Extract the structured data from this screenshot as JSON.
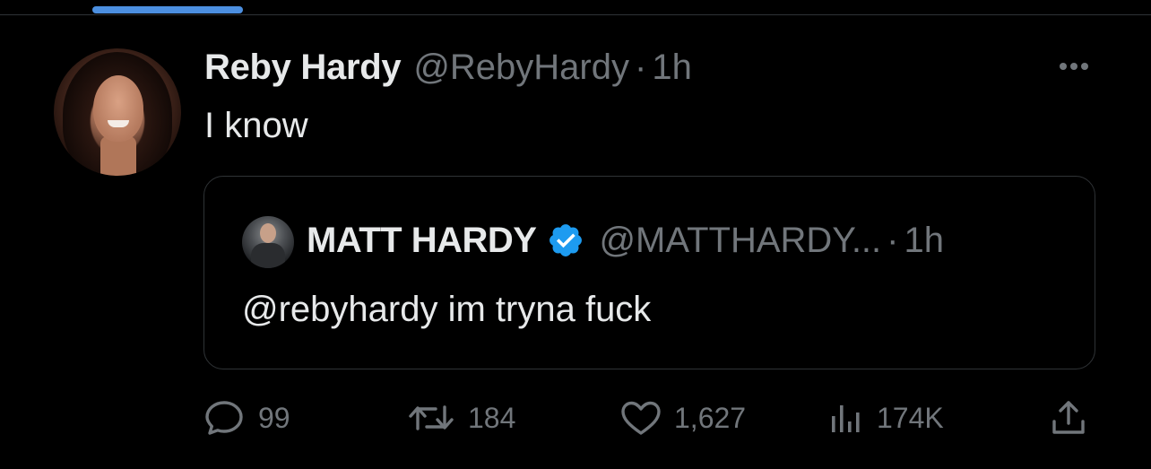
{
  "tweet": {
    "author": {
      "display_name": "Reby Hardy",
      "handle": "@RebyHardy",
      "separator": "·",
      "time": "1h"
    },
    "text": "I know",
    "quoted": {
      "display_name": "MATT HARDY",
      "handle": "@MATTHARDY...",
      "separator": "·",
      "time": "1h",
      "text": "@rebyhardy im tryna fuck"
    },
    "actions": {
      "replies": "99",
      "retweets": "184",
      "likes": "1,627",
      "views": "174K"
    }
  },
  "colors": {
    "background": "#000000",
    "primary_text": "#e7e9ea",
    "secondary_text": "#71767b",
    "border": "#2f3336",
    "verified_blue": "#1d9bf0",
    "tab_indicator": "#4c8fe0"
  },
  "icons": {
    "more": "more-horizontal-icon",
    "verified": "verified-badge-icon",
    "reply": "reply-bubble-icon",
    "retweet": "retweet-arrows-icon",
    "like": "heart-icon",
    "views": "bar-chart-icon",
    "share": "share-upload-icon"
  }
}
